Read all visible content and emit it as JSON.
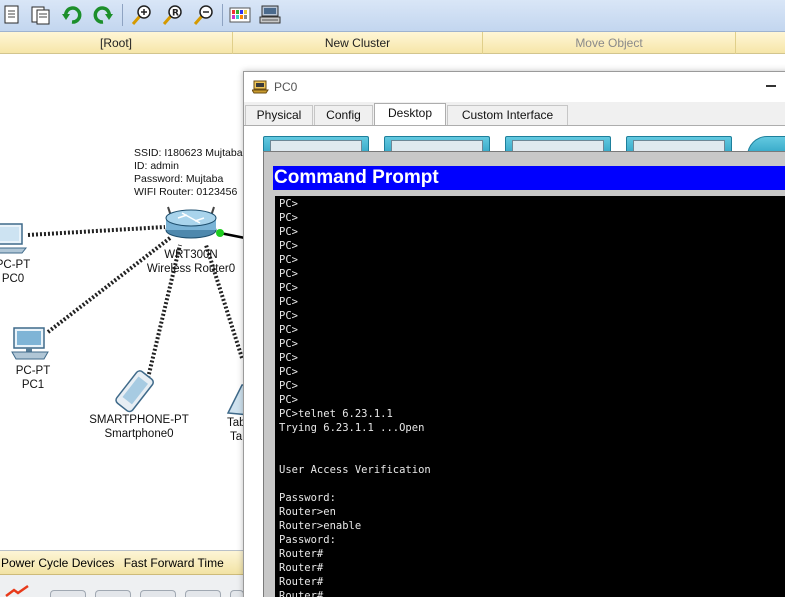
{
  "toolbar": {
    "buttons": [
      {
        "name": "new-file-icon"
      },
      {
        "name": "open-file-icon"
      },
      {
        "name": "undo-icon"
      },
      {
        "name": "redo-icon"
      },
      {
        "name": "zoom-in-icon"
      },
      {
        "name": "zoom-reset-icon"
      },
      {
        "name": "zoom-out-icon"
      },
      {
        "name": "palette-icon"
      },
      {
        "name": "device-dialog-icon"
      }
    ]
  },
  "crumbbar": {
    "root": "[Root]",
    "new_cluster": "New Cluster",
    "move_object": "Move Object"
  },
  "workspace": {
    "router_info": [
      "SSID: I180623 Mujtaba",
      "ID: admin",
      "Password: Mujtaba",
      "WIFI Router: 0123456"
    ],
    "devices": {
      "router": {
        "model": "WRT300N",
        "name": "Wireless Router0"
      },
      "pc0": {
        "model": "PC-PT",
        "name": "PC0"
      },
      "pc1": {
        "model": "PC-PT",
        "name": "PC1"
      },
      "phone": {
        "model": "SMARTPHONE-PT",
        "name": "Smartphone0"
      },
      "tablet": {
        "model": "Tab",
        "name": "Ta"
      }
    }
  },
  "bottombar": {
    "power_cycle": "Power Cycle Devices",
    "fast_forward": "Fast Forward Time"
  },
  "pc_window": {
    "title": "PC0",
    "tabs": [
      "Physical",
      "Config",
      "Desktop",
      "Custom Interface"
    ],
    "active_tab": "Desktop"
  },
  "command_prompt": {
    "title": "Command Prompt",
    "lines": [
      "PC>",
      "PC>",
      "PC>",
      "PC>",
      "PC>",
      "PC>",
      "PC>",
      "PC>",
      "PC>",
      "PC>",
      "PC>",
      "PC>",
      "PC>",
      "PC>",
      "PC>",
      "PC>telnet 6.23.1.1",
      "Trying 6.23.1.1 ...Open",
      "",
      "",
      "User Access Verification",
      "",
      "Password:",
      "Router>en",
      "Router>enable",
      "Password:",
      "Router#",
      "Router#",
      "Router#",
      "Router#"
    ]
  },
  "colors": {
    "cmd_header": "#0000ff",
    "terminal_bg": "#000000",
    "terminal_text": "#e8e8e8",
    "link_green": "#1fcc1f"
  }
}
